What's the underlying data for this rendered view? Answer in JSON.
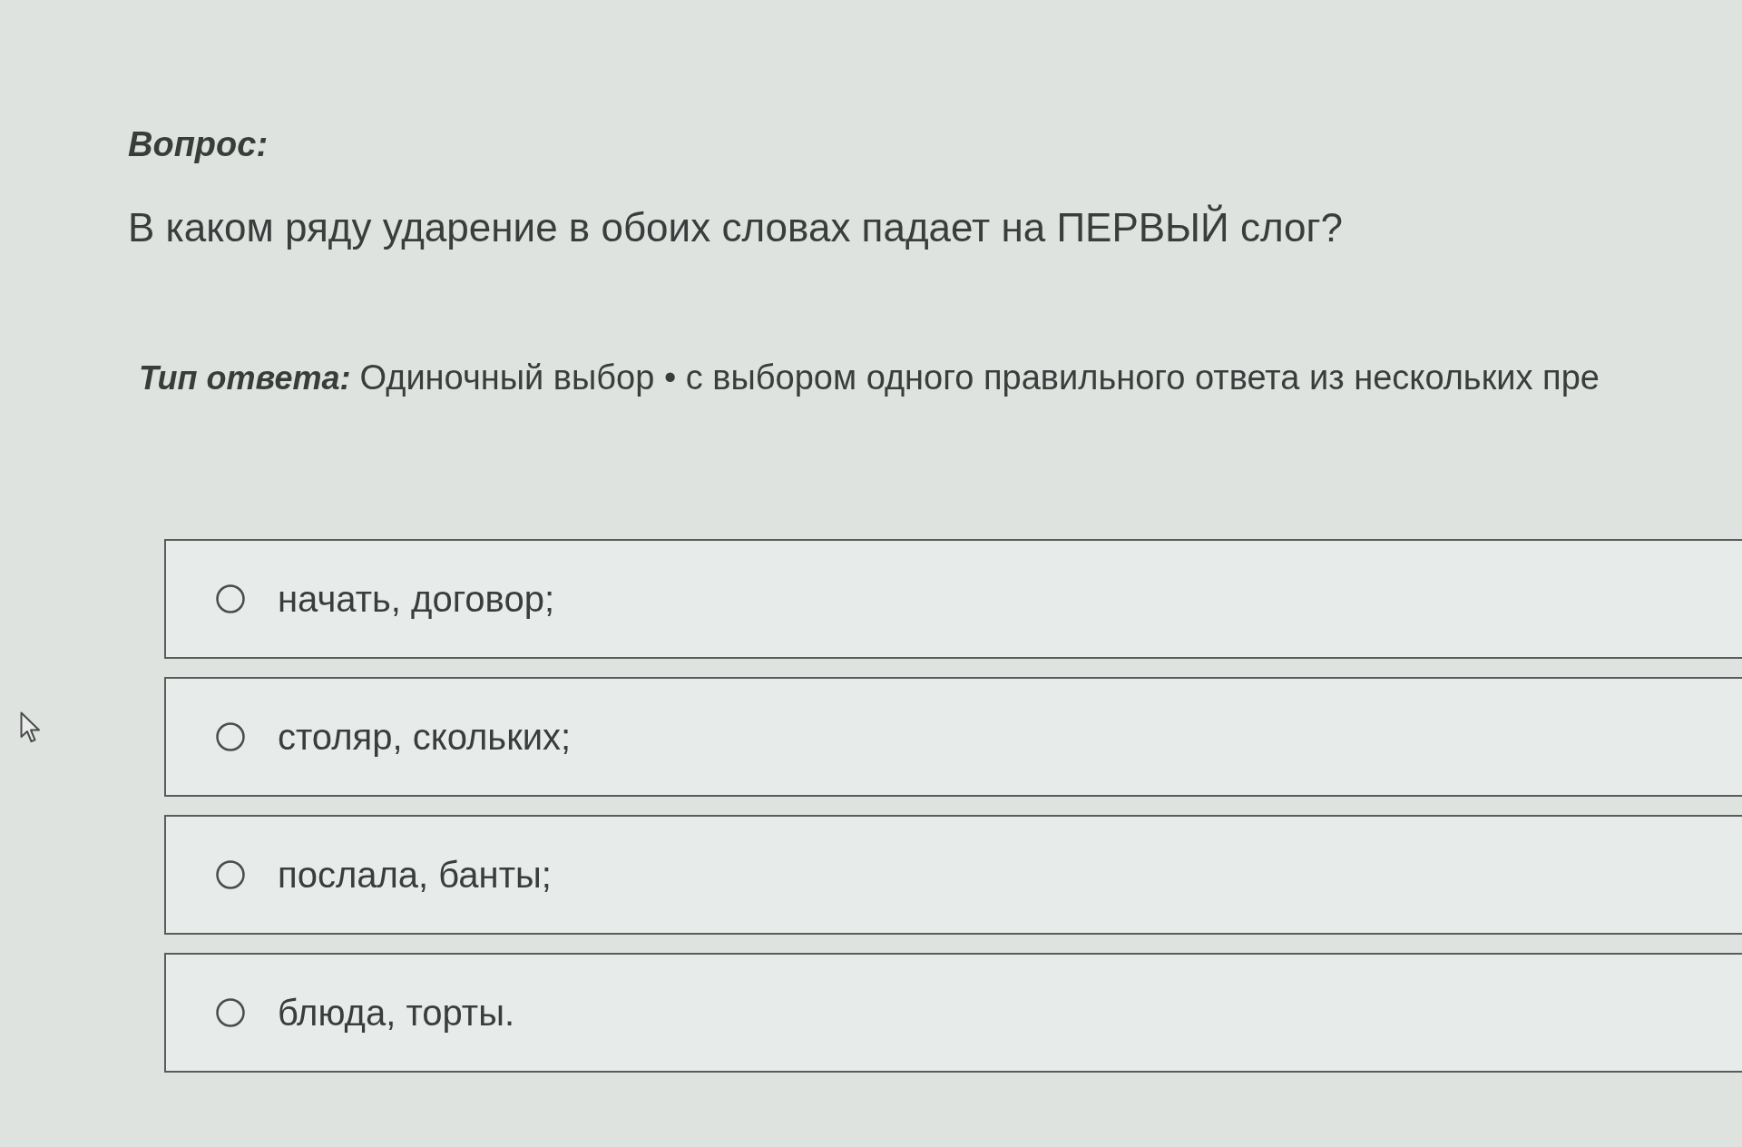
{
  "question": {
    "label": "Вопрос:",
    "text": "В каком ряду ударение в обоих словах падает на ПЕРВЫЙ слог?"
  },
  "answer_type": {
    "label": "Тип ответа:",
    "value": "Одиночный выбор • с выбором одного правильного ответа из нескольких пре"
  },
  "options": [
    {
      "text": "начать, договор;",
      "selected": false
    },
    {
      "text": "столяр, скольких;",
      "selected": false
    },
    {
      "text": "послала, банты;",
      "selected": false
    },
    {
      "text": "блюда, торты.",
      "selected": false
    }
  ]
}
